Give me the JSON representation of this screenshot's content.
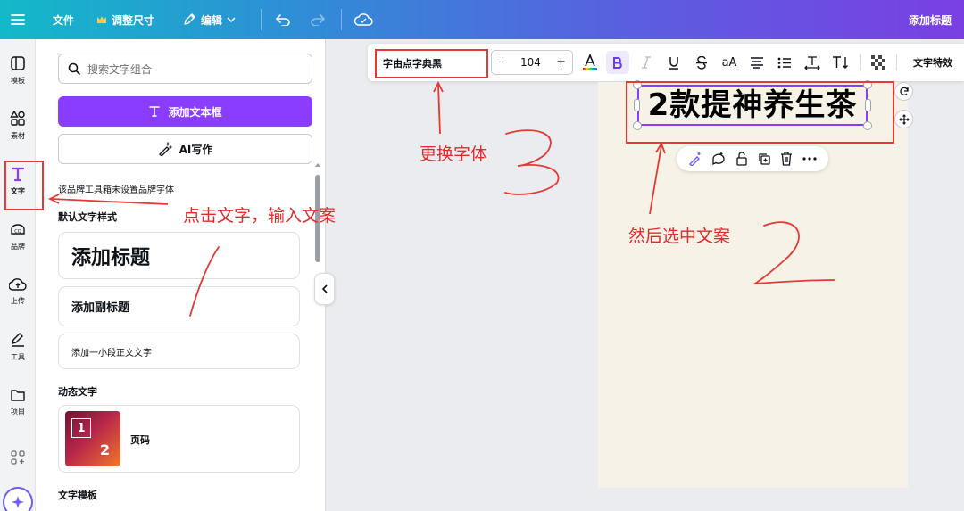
{
  "topbar": {
    "file": "文件",
    "resize": "调整尺寸",
    "edit": "编辑",
    "add_title": "添加标题"
  },
  "rail": [
    {
      "label": "模板",
      "icon": "template-icon"
    },
    {
      "label": "素材",
      "icon": "elements-icon"
    },
    {
      "label": "文字",
      "icon": "text-icon"
    },
    {
      "label": "品牌",
      "icon": "brand-icon"
    },
    {
      "label": "上传",
      "icon": "upload-icon"
    },
    {
      "label": "工具",
      "icon": "tools-icon"
    },
    {
      "label": "项目",
      "icon": "projects-icon"
    },
    {
      "label": "",
      "icon": "apps-icon"
    }
  ],
  "panel": {
    "search_placeholder": "搜索文字组合",
    "add_textbox": "添加文本框",
    "ai_write": "AI写作",
    "brand_note": "该品牌工具箱未设置品牌字体",
    "default_styles_title": "默认文字样式",
    "add_heading": "添加标题",
    "add_subheading": "添加副标题",
    "add_body": "添加一小段正文文字",
    "dynamic_title": "动态文字",
    "page_number": "页码",
    "thumb_digit_1": "1",
    "thumb_digit_2": "2",
    "templates_title": "文字模板"
  },
  "textbar": {
    "font": "字由点字典黑",
    "minus": "-",
    "size": "104",
    "plus": "+",
    "case": "aA",
    "effects": "文字特效"
  },
  "canvas": {
    "headline": "2款提神养生茶"
  },
  "annotations": {
    "change_font": "更换字体",
    "click_text": "点击文字，输入文案",
    "select_copy": "然后选中文案"
  },
  "colors": {
    "accent": "#8b3dff",
    "annotation": "#e53935",
    "page_bg": "#f7f2e7"
  }
}
